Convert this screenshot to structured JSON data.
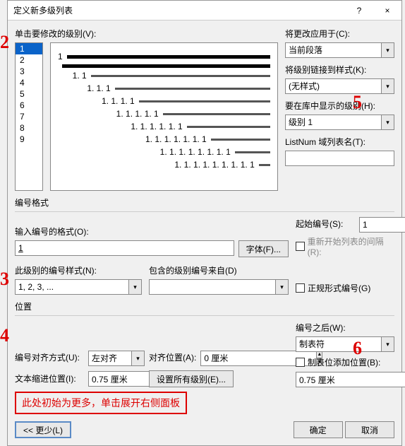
{
  "title": "定义新多级列表",
  "help_icon": "?",
  "close_icon": "×",
  "click_level_label": "单击要修改的级别(V):",
  "levels": [
    "1",
    "2",
    "3",
    "4",
    "5",
    "6",
    "7",
    "8",
    "9"
  ],
  "selected_level": "1",
  "preview": [
    {
      "indent": 0,
      "num": "1",
      "thick": true
    },
    {
      "indent": 0,
      "num": "",
      "thick": true
    },
    {
      "indent": 1,
      "num": "1. 1",
      "thick": false
    },
    {
      "indent": 2,
      "num": "1. 1. 1",
      "thick": false
    },
    {
      "indent": 3,
      "num": "1. 1. 1. 1",
      "thick": false
    },
    {
      "indent": 4,
      "num": "1. 1. 1. 1. 1",
      "thick": false
    },
    {
      "indent": 5,
      "num": "1. 1. 1. 1. 1. 1",
      "thick": false
    },
    {
      "indent": 6,
      "num": "1. 1. 1. 1. 1. 1. 1",
      "thick": false
    },
    {
      "indent": 7,
      "num": "1. 1. 1. 1. 1. 1. 1. 1",
      "thick": false
    },
    {
      "indent": 8,
      "num": "1. 1. 1. 1. 1. 1. 1. 1. 1",
      "thick": false
    }
  ],
  "right": {
    "apply_to_label": "将更改应用于(C):",
    "apply_to_value": "当前段落",
    "link_style_label": "将级别链接到样式(K):",
    "link_style_value": "(无样式)",
    "gallery_label": "要在库中显示的级别(H):",
    "gallery_value": "级别 1",
    "listnum_label": "ListNum 域列表名(T):",
    "listnum_value": ""
  },
  "numfmt": {
    "group": "编号格式",
    "enter_fmt_label": "输入编号的格式(O):",
    "enter_fmt_value": "1",
    "font_btn": "字体(F)...",
    "style_label": "此级别的编号样式(N):",
    "style_value": "1, 2, 3, ...",
    "include_prev_label": "包含的级别编号来自(D)",
    "include_prev_value": "",
    "start_at_label": "起始编号(S):",
    "start_at_value": "1",
    "restart_label": "重新开始列表的间隔(R):",
    "legal_label": "正规形式编号(G)"
  },
  "pos": {
    "group": "位置",
    "align_label": "编号对齐方式(U):",
    "align_value": "左对齐",
    "align_at_label": "对齐位置(A):",
    "align_at_value": "0 厘米",
    "indent_at_label": "文本缩进位置(I):",
    "indent_at_value": "0.75 厘米",
    "set_all_btn": "设置所有级别(E)...",
    "follow_label": "编号之后(W):",
    "follow_value": "制表符",
    "tab_add_label": "制表位添加位置(B):",
    "tab_add_value": "0.75 厘米"
  },
  "footer": {
    "less_btn": "<< 更少(L)",
    "ok_btn": "确定",
    "cancel_btn": "取消"
  },
  "annotation_text": "此处初始为更多，单击展开右侧面板",
  "ann": {
    "n2": "2",
    "n3": "3",
    "n4": "4",
    "n5": "5",
    "n6": "6"
  }
}
